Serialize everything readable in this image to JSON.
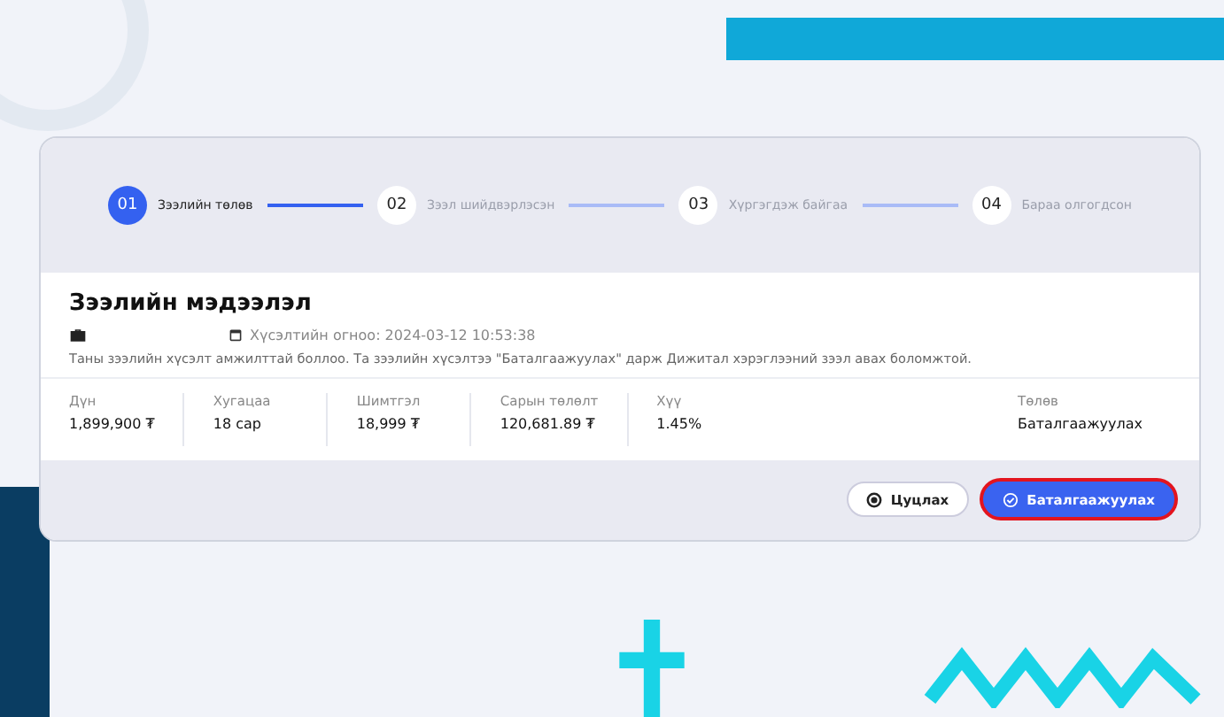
{
  "steps": [
    {
      "number": "01",
      "label": "Зээлийн төлөв",
      "selected": true
    },
    {
      "number": "02",
      "label": "Зээл шийдвэрлэсэн",
      "selected": false
    },
    {
      "number": "03",
      "label": "Хүргэгдэж байгаа",
      "selected": false
    },
    {
      "number": "04",
      "label": "Бараа олгогдсон",
      "selected": false
    }
  ],
  "info": {
    "title": "Зээлийн мэдээлэл",
    "date": "Хүсэлтийн огноо: 2024-03-12 10:53:38",
    "message": "Таны зээлийн хүсэлт амжилттай боллоо. Та зээлийн хүсэлтээ \"Баталгаажуулах\" дарж Дижитал хэрэглээний зээл авах боломжтой."
  },
  "stats": [
    {
      "label": "Дүн",
      "value": "1,899,900 ₮"
    },
    {
      "label": "Хугацаа",
      "value": "18 сар"
    },
    {
      "label": "Шимтгэл",
      "value": "18,999 ₮"
    },
    {
      "label": "Сарын төлөлт",
      "value": "120,681.89 ₮"
    },
    {
      "label": "Хүү",
      "value": "1.45%"
    }
  ],
  "status": {
    "label": "Төлөв",
    "value": "Баталгаажуулах"
  },
  "buttons": [
    {
      "kind": "cancel",
      "label": "Цуцлах",
      "highlighted": false
    },
    {
      "kind": "confirm",
      "label": "Баталгаажуулах",
      "highlighted": true
    }
  ]
}
